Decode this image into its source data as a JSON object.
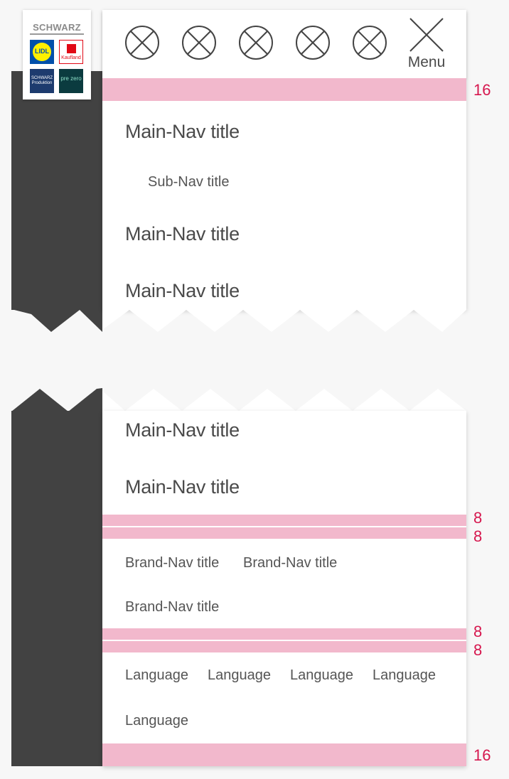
{
  "header": {
    "logo": {
      "brand_text": "SCHWARZ",
      "tiles": [
        {
          "label": "LIDL",
          "color": "#0050aa",
          "accent": "#fff000"
        },
        {
          "label": "Kaufland",
          "color": "#e10915"
        },
        {
          "label": "SCHWARZ Produktion",
          "color": "#1d3b6e"
        },
        {
          "label": "pre zero",
          "color": "#0b3b3f"
        }
      ]
    },
    "icons": [
      "placeholder-icon",
      "placeholder-icon",
      "placeholder-icon",
      "placeholder-icon",
      "placeholder-icon"
    ],
    "menu_label": "Menu"
  },
  "nav_top": {
    "items": [
      {
        "type": "main",
        "label": "Main-Nav title"
      },
      {
        "type": "sub",
        "label": "Sub-Nav title"
      },
      {
        "type": "main",
        "label": "Main-Nav title"
      },
      {
        "type": "main",
        "label": "Main-Nav title"
      }
    ]
  },
  "nav_bottom": {
    "main_items": [
      "Main-Nav title",
      "Main-Nav title"
    ],
    "brand_items": [
      "Brand-Nav title",
      "Brand-Nav title",
      "Brand-Nav title"
    ],
    "languages": [
      "Language",
      "Language",
      "Language",
      "Language",
      "Language"
    ]
  },
  "spacing_marks": [
    "16",
    "8",
    "8",
    "8",
    "8",
    "16"
  ],
  "colors": {
    "dark_bar": "#424242",
    "spacing": "#f2b8cc",
    "spacing_label": "#d6174e",
    "panel": "#ffffff"
  }
}
